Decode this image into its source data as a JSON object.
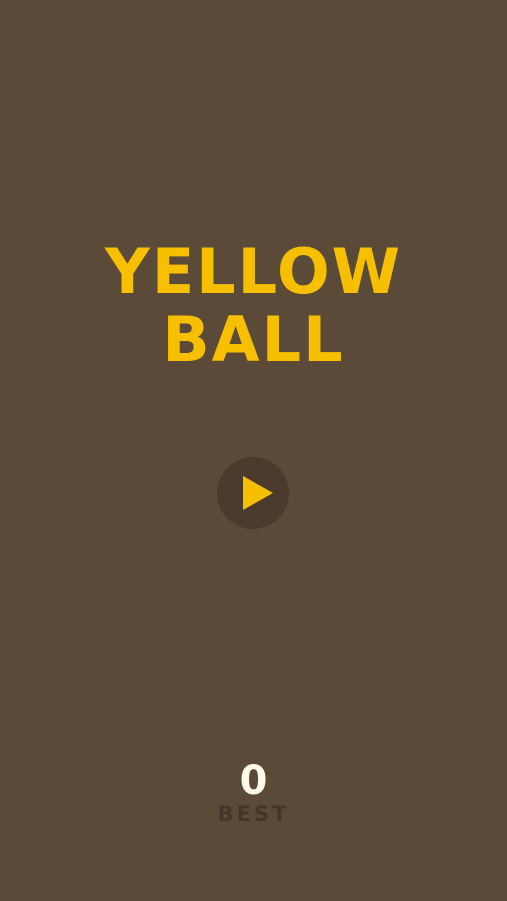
{
  "title": {
    "line1": "YELLOW",
    "line2": "BALL"
  },
  "play_button": {
    "icon": "play-icon"
  },
  "best": {
    "score": "0",
    "label": "BEST"
  },
  "colors": {
    "background": "#5c4a38",
    "accent": "#f6c000",
    "button_bg": "#4a3b2d",
    "score_text": "#fffbe8",
    "label_text": "#443628"
  }
}
